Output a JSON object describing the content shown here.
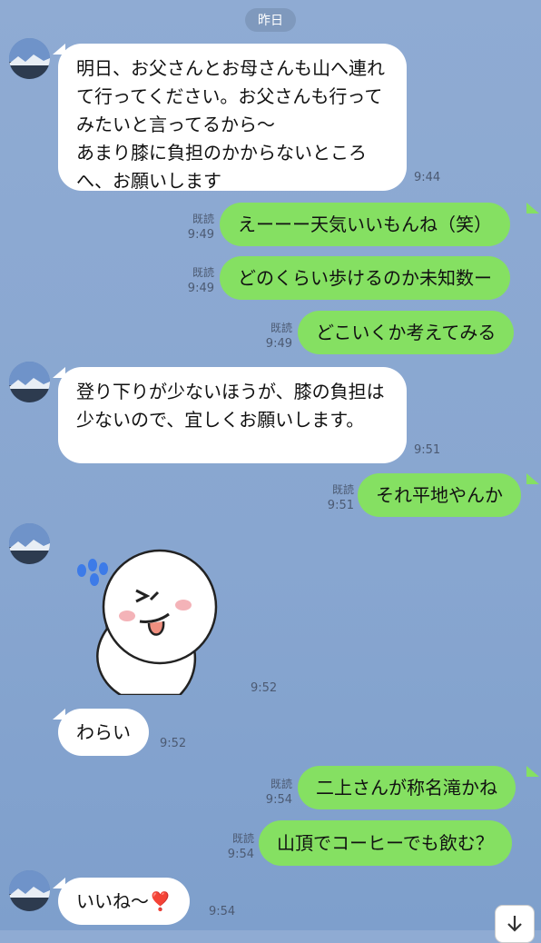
{
  "date_divider": "昨日",
  "colors": {
    "outgoing": "#85e062",
    "incoming": "#ffffff",
    "background": "#8fabd3"
  },
  "messages": [
    {
      "from": "other",
      "text": "明日、お父さんとお母さんも山へ連れて行ってください。お父さんも行ってみたいと言ってるから〜\nあまり膝に負担のかからないところへ、お願いします",
      "time": "9:44"
    },
    {
      "from": "me",
      "text": "えーーー天気いいもんね（笑）",
      "read": "既読",
      "time": "9:49"
    },
    {
      "from": "me",
      "text": "どのくらい歩けるのか未知数ー",
      "read": "既読",
      "time": "9:49"
    },
    {
      "from": "me",
      "text": "どこいくか考えてみる",
      "read": "既読",
      "time": "9:49"
    },
    {
      "from": "other",
      "text": "登り下りが少ないほうが、膝の負担は少ないので、宜しくお願いします。",
      "time": "9:51"
    },
    {
      "from": "me",
      "text": "それ平地やんか",
      "read": "既読",
      "time": "9:51"
    },
    {
      "from": "other",
      "sticker": "sweating-wink-sticker",
      "time": "9:52"
    },
    {
      "from": "other",
      "text": "わらい",
      "time": "9:52"
    },
    {
      "from": "me",
      "text": "二上さんが称名滝かね",
      "read": "既読",
      "time": "9:54"
    },
    {
      "from": "me",
      "text": "山頂でコーヒーでも飲む？",
      "read": "既読",
      "time": "9:54"
    },
    {
      "from": "other",
      "text": "いいね〜",
      "emoji": "❣️",
      "time": "9:54"
    }
  ]
}
